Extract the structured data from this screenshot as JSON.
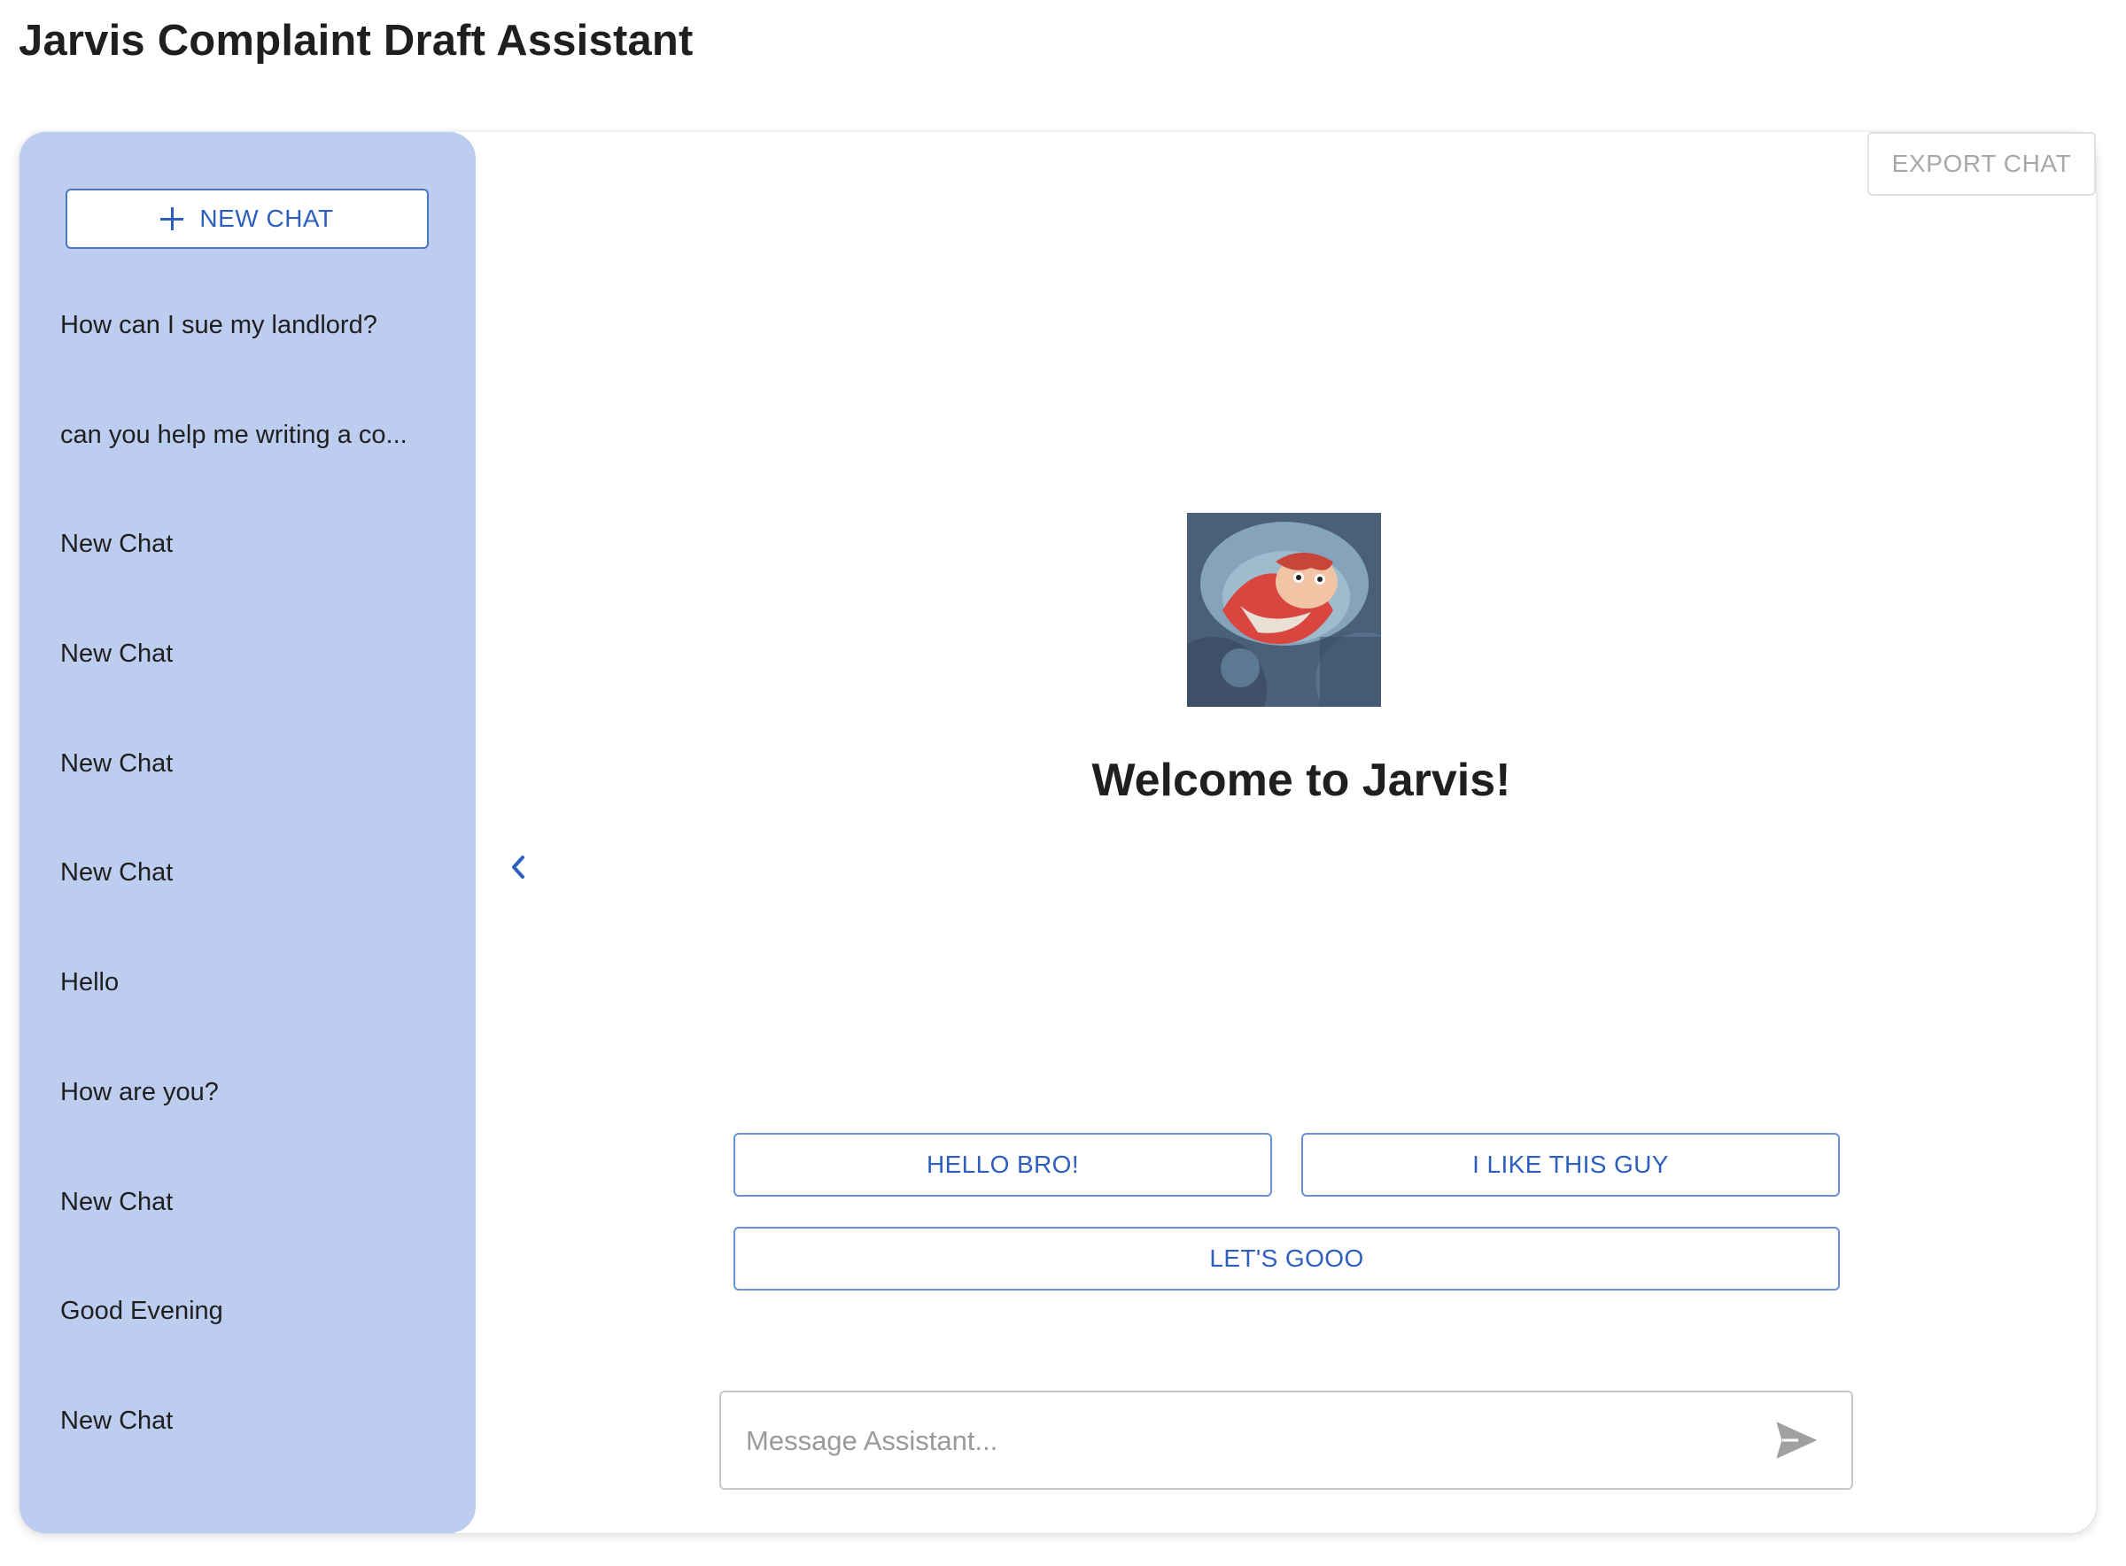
{
  "app": {
    "title": "Jarvis Complaint Draft Assistant"
  },
  "sidebar": {
    "new_chat_label": "NEW CHAT",
    "items": [
      {
        "label": "How can I sue my landlord?"
      },
      {
        "label": "can you help me writing a co..."
      },
      {
        "label": "New Chat"
      },
      {
        "label": "New Chat"
      },
      {
        "label": "New Chat"
      },
      {
        "label": "New Chat"
      },
      {
        "label": "Hello"
      },
      {
        "label": "How are you?"
      },
      {
        "label": "New Chat"
      },
      {
        "label": "Good Evening"
      },
      {
        "label": "New Chat"
      }
    ]
  },
  "main": {
    "export_label": "EXPORT CHAT",
    "welcome": "Welcome to Jarvis!",
    "suggestions": [
      "HELLO BRO!",
      "I LIKE THIS GUY",
      "LET'S GOOO"
    ],
    "input": {
      "value": "",
      "placeholder": "Message Assistant..."
    }
  },
  "icons": {
    "new_chat": "plus-icon",
    "collapse": "chevron-left-icon",
    "send": "send-icon",
    "avatar": "avatar-image"
  },
  "colors": {
    "sidebar_bg": "#bccdef",
    "accent": "#2e5fbf",
    "button_border": "#6a91d8",
    "export_disabled_text": "#a8a8a8",
    "send_icon": "#a0a0a0"
  }
}
